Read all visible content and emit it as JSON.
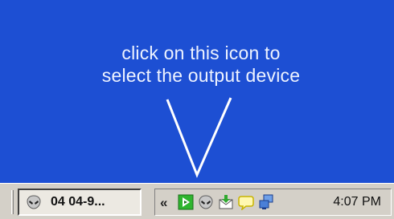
{
  "annotation": {
    "line1": "click on this icon to",
    "line2": "select the output device"
  },
  "taskbar": {
    "task_label": "04 04-9...",
    "tray_expand_label": "«",
    "clock": "4:07 PM"
  },
  "colors": {
    "desktop": "#1d4fd3",
    "taskbar": "#d4d0c8",
    "annotation_text": "#eef3ff"
  },
  "icons": {
    "task": "alien-head-icon",
    "tray": [
      "output-device-play-icon",
      "alien-head-icon",
      "mail-download-icon",
      "speech-bubble-icon",
      "network-computers-icon"
    ]
  }
}
